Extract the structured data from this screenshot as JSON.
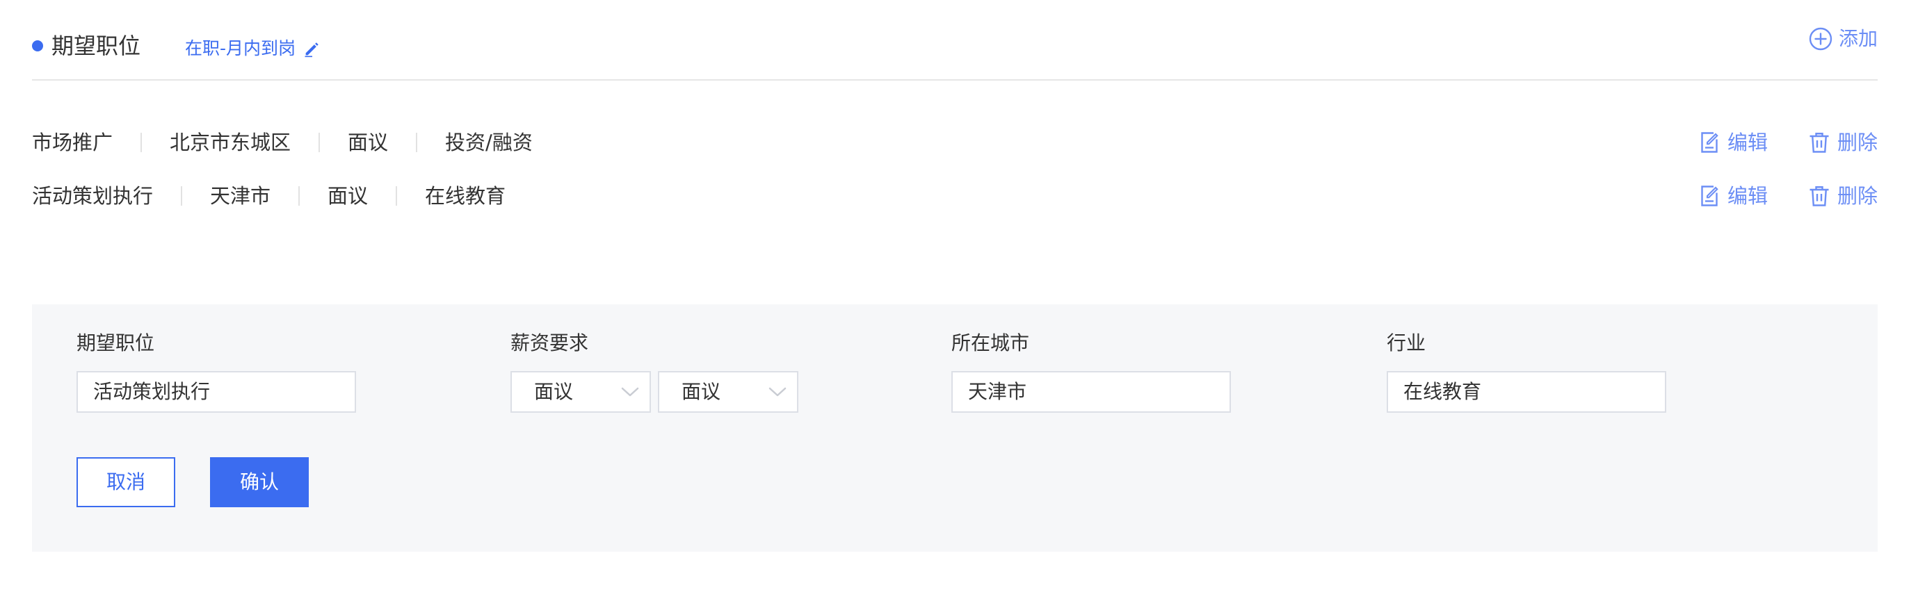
{
  "header": {
    "title": "期望职位",
    "status": "在职-月内到岗",
    "add_label": "添加",
    "accent_color": "#3b6cf0"
  },
  "rows": [
    {
      "tags": [
        "市场推广",
        "北京市东城区",
        "面议",
        "投资/融资"
      ],
      "edit_label": "编辑",
      "delete_label": "删除"
    },
    {
      "tags": [
        "活动策划执行",
        "天津市",
        "面议",
        "在线教育"
      ],
      "edit_label": "编辑",
      "delete_label": "删除"
    }
  ],
  "form": {
    "position": {
      "label": "期望职位",
      "value": "活动策划执行"
    },
    "salary": {
      "label": "薪资要求",
      "min": "面议",
      "max": "面议"
    },
    "city": {
      "label": "所在城市",
      "value": "天津市"
    },
    "industry": {
      "label": "行业",
      "value": "在线教育"
    },
    "cancel_label": "取消",
    "confirm_label": "确认"
  },
  "icons": {
    "status_edit": "pencil-icon",
    "add": "plus-circle-icon",
    "edit": "edit-document-icon",
    "delete": "trash-icon",
    "dropdown": "chevron-down-icon"
  }
}
